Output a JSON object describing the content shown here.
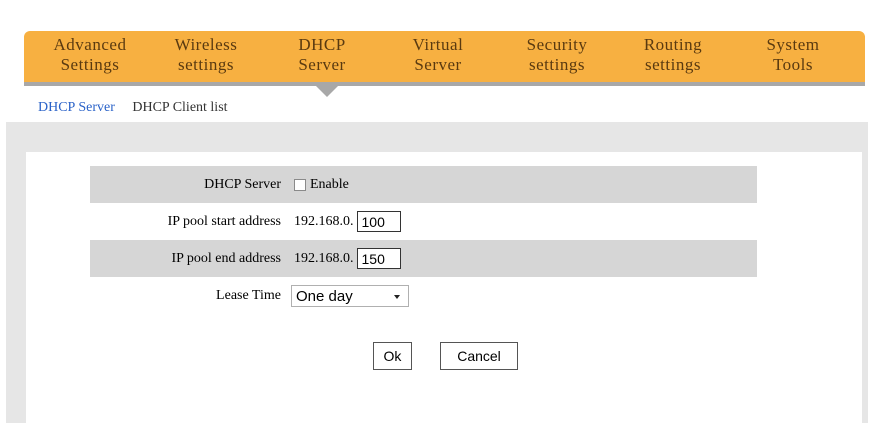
{
  "nav": {
    "items": [
      {
        "line1": "Advanced",
        "line2": "Settings"
      },
      {
        "line1": "Wireless",
        "line2": "settings"
      },
      {
        "line1": "DHCP",
        "line2": "Server"
      },
      {
        "line1": "Virtual",
        "line2": "Server"
      },
      {
        "line1": "Security",
        "line2": "settings"
      },
      {
        "line1": "Routing",
        "line2": "settings"
      },
      {
        "line1": "System",
        "line2": "Tools"
      }
    ]
  },
  "subnav": {
    "dhcp_server": "DHCP Server",
    "dhcp_client_list": "DHCP Client list"
  },
  "form": {
    "dhcp_server_label": "DHCP Server",
    "enable_label": "Enable",
    "enable_checked": false,
    "ip_start_label": "IP pool start address",
    "ip_prefix": "192.168.0.",
    "ip_start_value": "100",
    "ip_end_label": "IP pool end address",
    "ip_end_value": "150",
    "lease_label": "Lease Time",
    "lease_value": "One day"
  },
  "buttons": {
    "ok": "Ok",
    "cancel": "Cancel"
  },
  "colors": {
    "nav_bg": "#f7b041",
    "active_link": "#2a62c8"
  }
}
